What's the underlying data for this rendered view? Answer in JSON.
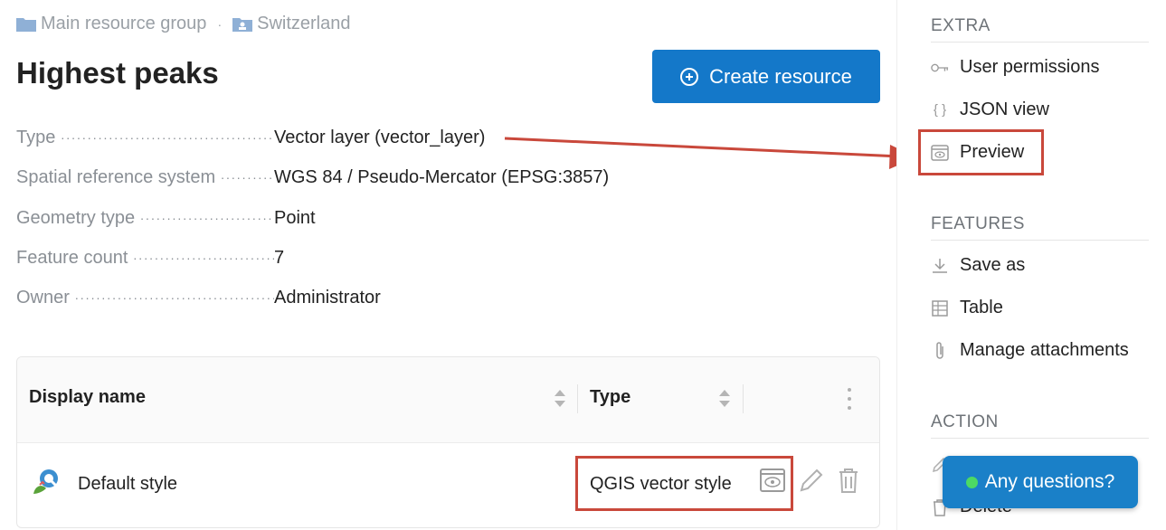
{
  "breadcrumb": {
    "items": [
      "Main resource group",
      "Switzerland"
    ]
  },
  "page": {
    "title": "Highest peaks",
    "create_button": "Create resource"
  },
  "info": [
    {
      "key": "Type",
      "value": "Vector layer (vector_layer)"
    },
    {
      "key": "Spatial reference system",
      "value": "WGS 84 / Pseudo-Mercator (EPSG:3857)"
    },
    {
      "key": "Geometry type",
      "value": "Point"
    },
    {
      "key": "Feature count",
      "value": "7"
    },
    {
      "key": "Owner",
      "value": "Administrator"
    }
  ],
  "table": {
    "columns": [
      "Display name",
      "Type"
    ],
    "rows": [
      {
        "name": "Default style",
        "type": "QGIS vector style"
      }
    ]
  },
  "sidebar": {
    "extra_title": "EXTRA",
    "extra_items": [
      "User permissions",
      "JSON view",
      "Preview"
    ],
    "features_title": "FEATURES",
    "features_items": [
      "Save as",
      "Table",
      "Manage attachments"
    ],
    "action_title": "ACTION",
    "action_items": [
      "Delete"
    ]
  },
  "chat": {
    "label": "Any questions?"
  },
  "colors": {
    "accent": "#1478c9",
    "highlight": "#c9483b",
    "chat": "#1a80c8"
  }
}
